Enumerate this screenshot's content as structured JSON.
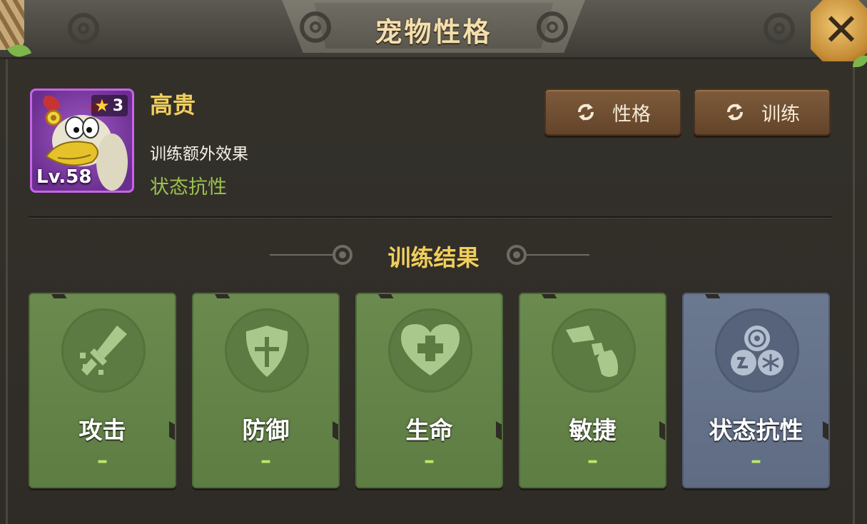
{
  "header": {
    "title": "宠物性格"
  },
  "close_button": {
    "icon": "close-icon"
  },
  "pet": {
    "star_count": "3",
    "level": "Lv.58",
    "personality": "高贵",
    "bonus_label": "训练额外效果",
    "bonus_value": "状态抗性",
    "frame_color": "#c764e8"
  },
  "buttons": {
    "personality_label": "性格",
    "training_label": "训练"
  },
  "section": {
    "title": "训练结果"
  },
  "cards": [
    {
      "label": "攻击",
      "value": "–",
      "icon": "sword-icon",
      "selected": false
    },
    {
      "label": "防御",
      "value": "–",
      "icon": "shield-icon",
      "selected": false
    },
    {
      "label": "生命",
      "value": "–",
      "icon": "heart-plus-icon",
      "selected": false
    },
    {
      "label": "敏捷",
      "value": "–",
      "icon": "boot-icon",
      "selected": false
    },
    {
      "label": "状态抗性",
      "value": "–",
      "icon": "status-resist-icon",
      "selected": true
    }
  ],
  "colors": {
    "accent_gold": "#f1cf5c",
    "stat_green": "#9ac24e",
    "card_green": "#6b8a4e",
    "card_selected": "#6a7890"
  }
}
